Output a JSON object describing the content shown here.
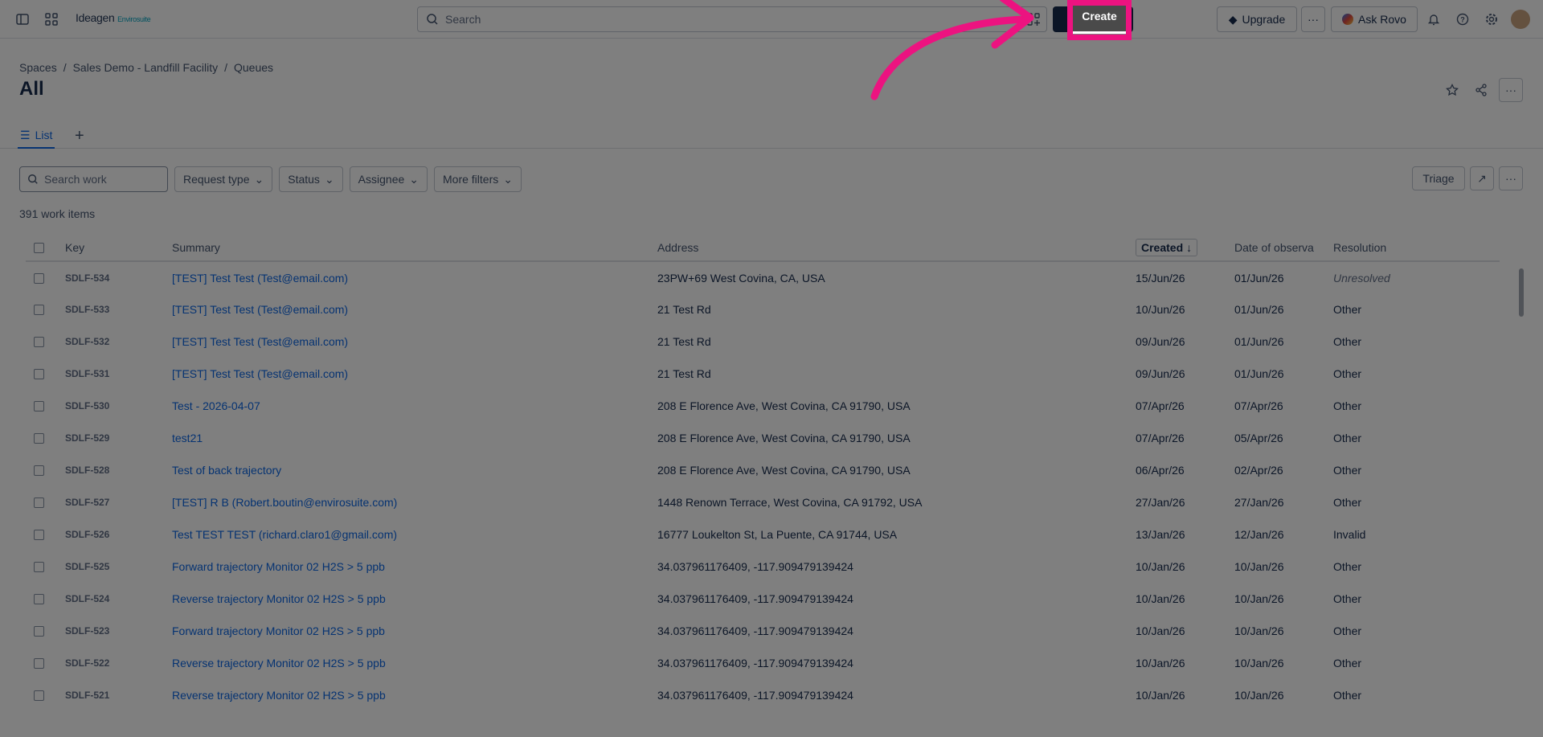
{
  "topbar": {
    "logo_main": "Ideagen",
    "logo_sub": "Envirosuite",
    "search_placeholder": "Search",
    "create_label": "Create",
    "upgrade_label": "Upgrade",
    "ask_rovo_label": "Ask Rovo",
    "icons": [
      "sidebar-toggle-icon",
      "app-switcher-icon",
      "search-icon",
      "apps-add-icon",
      "plus-icon",
      "diamond-icon",
      "more-icon",
      "rovo-icon",
      "bell-icon",
      "help-icon",
      "gear-icon",
      "avatar"
    ]
  },
  "breadcrumb": [
    "Spaces",
    "Sales Demo - Landfill Facility",
    "Queues"
  ],
  "page": {
    "title": "All"
  },
  "tabs": {
    "list_label": "List"
  },
  "filters": {
    "search_placeholder": "Search work",
    "request_type": "Request type",
    "status": "Status",
    "assignee": "Assignee",
    "more_filters": "More filters"
  },
  "actions": {
    "triage_label": "Triage"
  },
  "count_label": "391 work items",
  "table": {
    "headers": {
      "key": "Key",
      "summary": "Summary",
      "address": "Address",
      "created": "Created",
      "date_obs": "Date of observa",
      "resolution": "Resolution"
    },
    "rows": [
      {
        "key": "SDLF-534",
        "summary": "[TEST] Test Test (Test@email.com)",
        "address": "23PW+69 West Covina, CA, USA",
        "created": "15/Jun/26",
        "date_obs": "01/Jun/26",
        "resolution": "Unresolved"
      },
      {
        "key": "SDLF-533",
        "summary": "[TEST] Test Test (Test@email.com)",
        "address": "21 Test Rd",
        "created": "10/Jun/26",
        "date_obs": "01/Jun/26",
        "resolution": "Other"
      },
      {
        "key": "SDLF-532",
        "summary": "[TEST] Test Test (Test@email.com)",
        "address": "21 Test Rd",
        "created": "09/Jun/26",
        "date_obs": "01/Jun/26",
        "resolution": "Other"
      },
      {
        "key": "SDLF-531",
        "summary": "[TEST] Test Test (Test@email.com)",
        "address": "21 Test Rd",
        "created": "09/Jun/26",
        "date_obs": "01/Jun/26",
        "resolution": "Other"
      },
      {
        "key": "SDLF-530",
        "summary": "Test - 2026-04-07",
        "address": "208 E Florence Ave, West Covina, CA 91790, USA",
        "created": "07/Apr/26",
        "date_obs": "07/Apr/26",
        "resolution": "Other"
      },
      {
        "key": "SDLF-529",
        "summary": "test21",
        "address": "208 E Florence Ave, West Covina, CA 91790, USA",
        "created": "07/Apr/26",
        "date_obs": "05/Apr/26",
        "resolution": "Other"
      },
      {
        "key": "SDLF-528",
        "summary": "Test of back trajectory",
        "address": "208 E Florence Ave, West Covina, CA 91790, USA",
        "created": "06/Apr/26",
        "date_obs": "02/Apr/26",
        "resolution": "Other"
      },
      {
        "key": "SDLF-527",
        "summary": "[TEST] R B (Robert.boutin@envirosuite.com)",
        "address": "1448 Renown Terrace, West Covina, CA 91792, USA",
        "created": "27/Jan/26",
        "date_obs": "27/Jan/26",
        "resolution": "Other"
      },
      {
        "key": "SDLF-526",
        "summary": "Test TEST TEST (richard.claro1@gmail.com)",
        "address": "16777 Loukelton St, La Puente, CA 91744, USA",
        "created": "13/Jan/26",
        "date_obs": "12/Jan/26",
        "resolution": "Invalid"
      },
      {
        "key": "SDLF-525",
        "summary": "Forward trajectory Monitor 02 H2S > 5 ppb",
        "address": "34.037961176409, -117.909479139424",
        "created": "10/Jan/26",
        "date_obs": "10/Jan/26",
        "resolution": "Other"
      },
      {
        "key": "SDLF-524",
        "summary": "Reverse trajectory Monitor 02 H2S > 5 ppb",
        "address": "34.037961176409, -117.909479139424",
        "created": "10/Jan/26",
        "date_obs": "10/Jan/26",
        "resolution": "Other"
      },
      {
        "key": "SDLF-523",
        "summary": "Forward trajectory Monitor 02 H2S > 5 ppb",
        "address": "34.037961176409, -117.909479139424",
        "created": "10/Jan/26",
        "date_obs": "10/Jan/26",
        "resolution": "Other"
      },
      {
        "key": "SDLF-522",
        "summary": "Reverse trajectory Monitor 02 H2S > 5 ppb",
        "address": "34.037961176409, -117.909479139424",
        "created": "10/Jan/26",
        "date_obs": "10/Jan/26",
        "resolution": "Other"
      },
      {
        "key": "SDLF-521",
        "summary": "Reverse trajectory Monitor 02 H2S > 5 ppb",
        "address": "34.037961176409, -117.909479139424",
        "created": "10/Jan/26",
        "date_obs": "10/Jan/26",
        "resolution": "Other"
      }
    ]
  },
  "annotation": {
    "highlight_color": "#ec1380"
  }
}
